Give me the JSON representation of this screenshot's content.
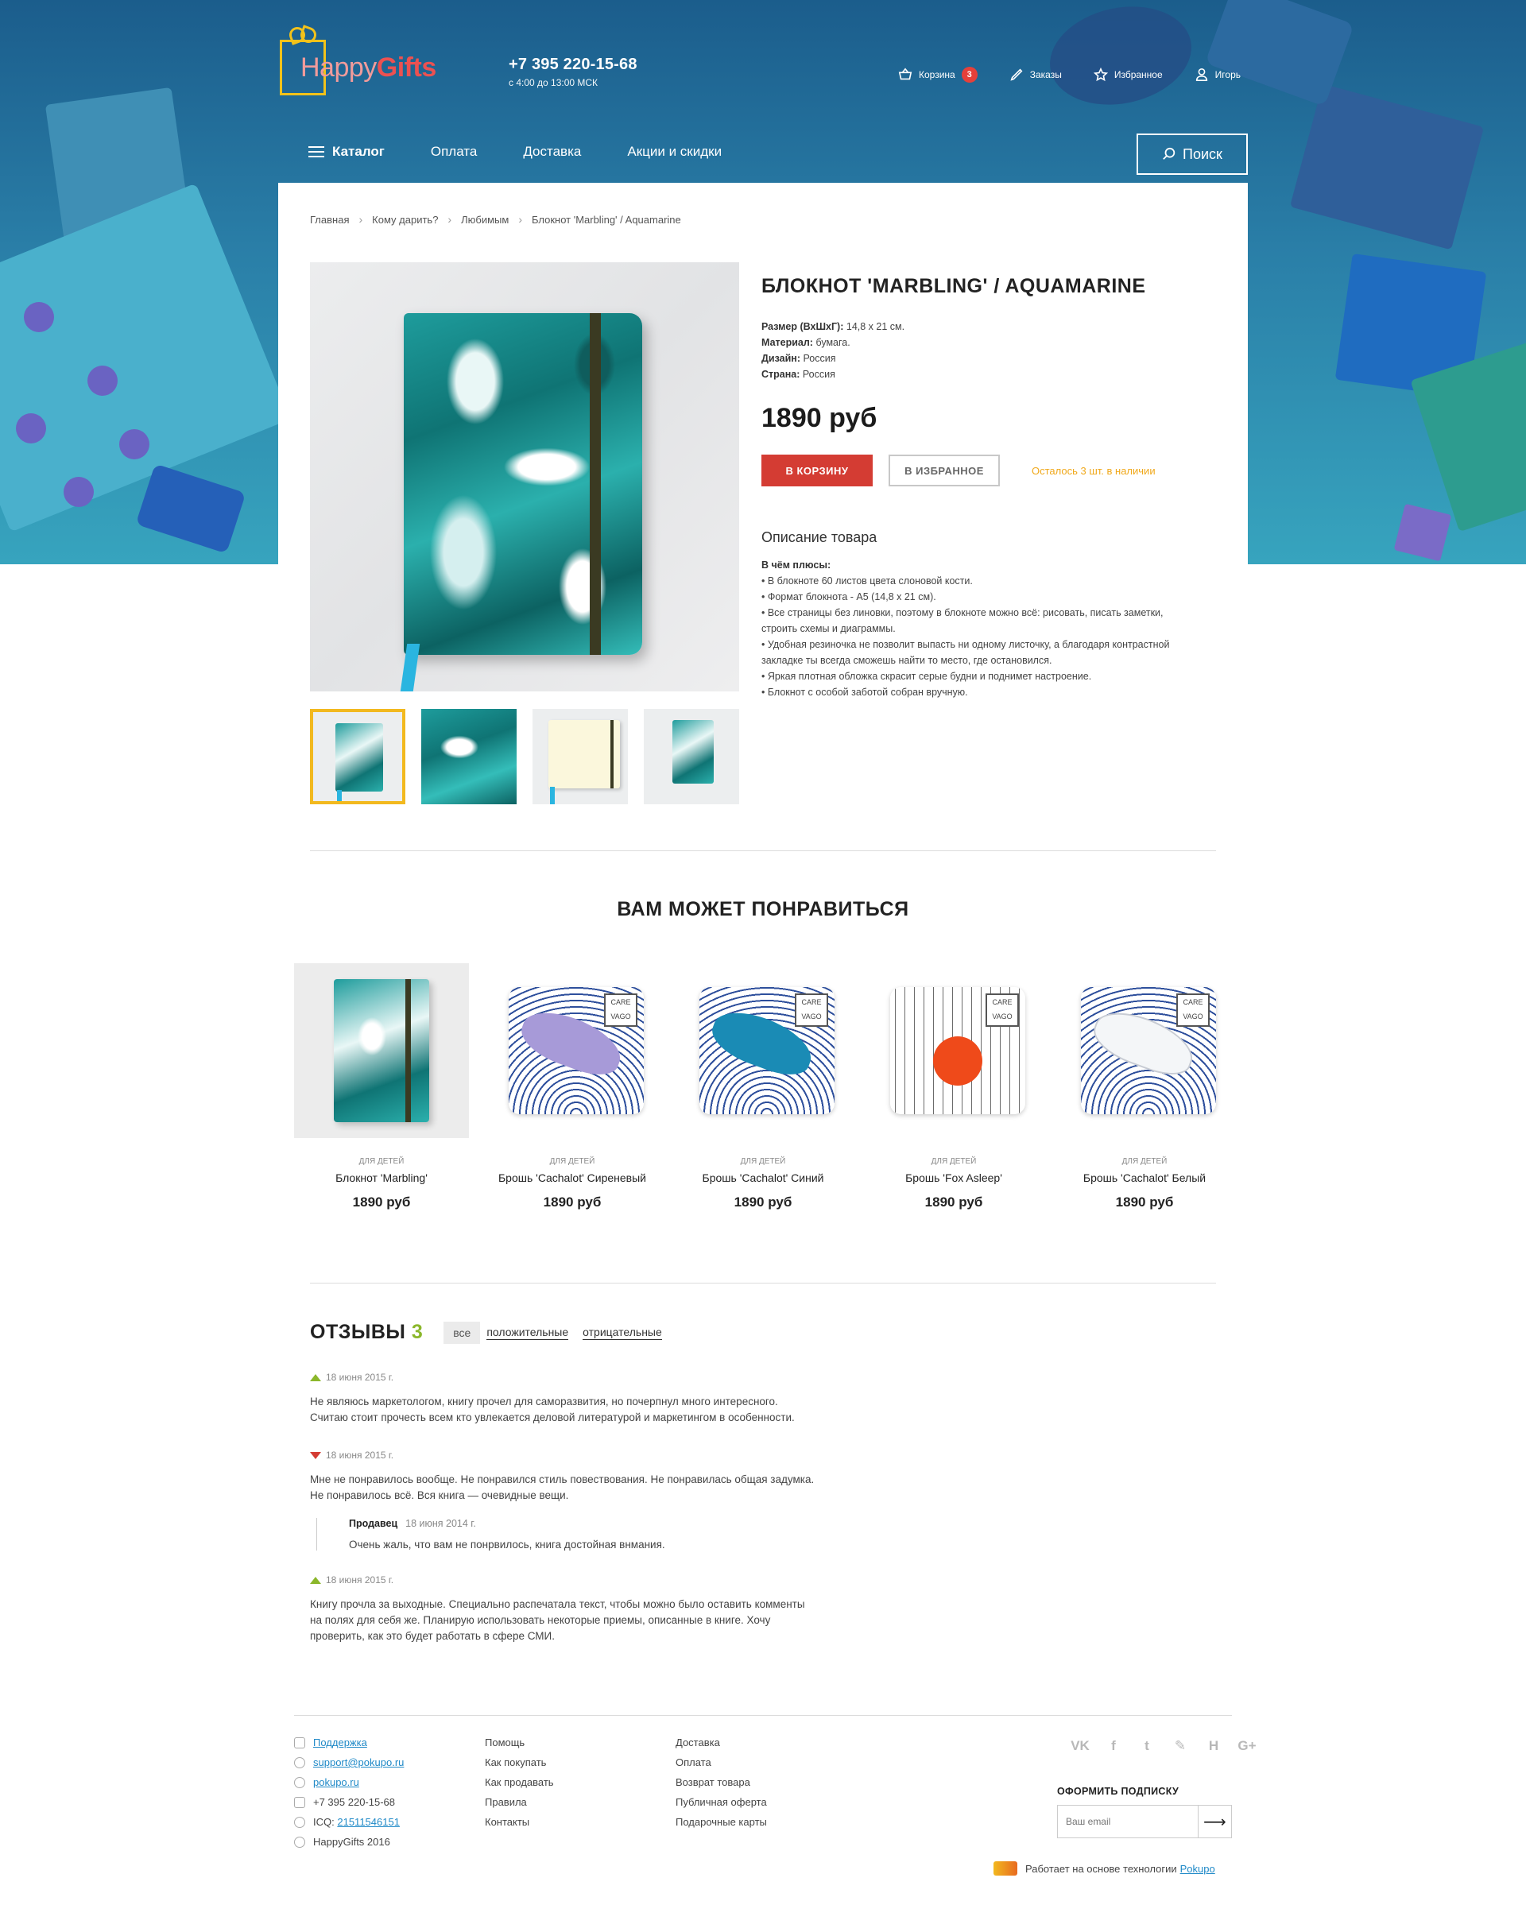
{
  "brand": {
    "logo_light": "Happy",
    "logo_bold": "Gifts"
  },
  "header": {
    "phone": "+7 395 220-15-68",
    "hours": "с 4:00 до 13:00 МСК",
    "cart_label": "Корзина",
    "cart_count": "3",
    "orders_label": "Заказы",
    "favorites_label": "Избранное",
    "user_label": "Игорь"
  },
  "nav": {
    "catalog": "Каталог",
    "items": [
      "Оплата",
      "Доставка",
      "Акции и скидки"
    ],
    "search": "Поиск"
  },
  "breadcrumbs": [
    "Главная",
    "Кому дарить?",
    "Любимым",
    "Блокнот 'Marbling' / Aquamarine"
  ],
  "product": {
    "title": "БЛОКНОТ 'MARBLING' / AQUAMARINE",
    "specs": [
      {
        "label": "Размер (ВхШхГ):",
        "value": "14,8 х 21 см."
      },
      {
        "label": "Материал:",
        "value": "бумага."
      },
      {
        "label": "Дизайн:",
        "value": "Россия"
      },
      {
        "label": "Страна:",
        "value": "Россия"
      }
    ],
    "price": "1890 руб",
    "cart_button": "В КОРЗИНУ",
    "fav_button": "В ИЗБРАННОЕ",
    "stock": "Осталось 3 шт. в наличии",
    "description_title": "Описание товара",
    "description_heading": "В чём плюсы:",
    "description_lines": [
      "• В блокноте 60 листов цвета слоновой кости.",
      "• Формат блокнота - А5 (14,8 х 21 см).",
      "• Все страницы без линовки, поэтому в блокноте можно всё: рисовать, писать заметки, строить схемы и диаграммы.",
      "• Удобная резиночка не позволит выпасть ни одному листочку, а благодаря контрастной закладке ты всегда сможешь найти то место, где остановился.",
      "• Яркая плотная обложка скрасит серые будни и поднимет настроение.",
      "• Блокнот с особой заботой собран вручную."
    ]
  },
  "recommendations": {
    "title": "ВАМ МОЖЕТ ПОНРАВИТЬСЯ",
    "items": [
      {
        "category": "ДЛЯ ДЕТЕЙ",
        "name": "Блокнот 'Marbling'",
        "price": "1890 руб"
      },
      {
        "category": "ДЛЯ ДЕТЕЙ",
        "name": "Брошь 'Cachalot' Сиреневый",
        "price": "1890 руб"
      },
      {
        "category": "ДЛЯ ДЕТЕЙ",
        "name": "Брошь 'Cachalot' Синий",
        "price": "1890 руб"
      },
      {
        "category": "ДЛЯ ДЕТЕЙ",
        "name": "Брошь 'Fox Asleep'",
        "price": "1890 руб"
      },
      {
        "category": "ДЛЯ ДЕТЕЙ",
        "name": "Брошь 'Cachalot' Белый",
        "price": "1890 руб"
      }
    ]
  },
  "reviews": {
    "title": "ОТЗЫВЫ",
    "count": "3",
    "filters": [
      "все",
      "положительные",
      "отрицательные"
    ],
    "items": [
      {
        "sentiment": "positive",
        "date": "18 июня 2015 г.",
        "text": "Не являюсь маркетологом, книгу прочел для саморазвития, но почерпнул много интересного. Считаю стоит прочесть всем кто увлекается деловой литературой и маркетингом в особенности."
      },
      {
        "sentiment": "negative",
        "date": "18 июня 2015 г.",
        "text": "Мне не понравилось вообще. Не понравился стиль повествования. Не понравилась общая задумка. Не понравилось всё. Вся книга — очевидные вещи.",
        "reply": {
          "author": "Продавец",
          "date": "18 июня 2014 г.",
          "text": "Очень жаль, что вам не понрвилось, книга достойная внмания."
        }
      },
      {
        "sentiment": "positive",
        "date": "18 июня 2015 г.",
        "text": "Книгу прочла за выходные. Специально распечатала текст, чтобы можно было оставить комменты на полях для себя же. Планирую использовать некоторые приемы, описанные в книге. Хочу проверить, как это будет работать в сфере СМИ."
      }
    ]
  },
  "footer": {
    "contacts": {
      "support": "Поддержка",
      "email": "support@pokupo.ru",
      "skype": "pokupo.ru",
      "phone": "+7 395 220-15-68",
      "icq_label": "ICQ:",
      "icq": "21511546151",
      "copyright": "HappyGifts 2016"
    },
    "col2": [
      "Помощь",
      "Как покупать",
      "Как продавать",
      "Правила",
      "Контакты"
    ],
    "col3": [
      "Доставка",
      "Оплата",
      "Возврат товара",
      "Публичная оферта",
      "Подарочные карты"
    ],
    "social": [
      "VK",
      "f",
      "t",
      "✎",
      "H",
      "G+"
    ],
    "subscribe_title": "ОФОРМИТЬ ПОДПИСКУ",
    "subscribe_placeholder": "Ваш email",
    "powered_text": "Работает на основе технологии",
    "powered_link": "Pokupo"
  }
}
